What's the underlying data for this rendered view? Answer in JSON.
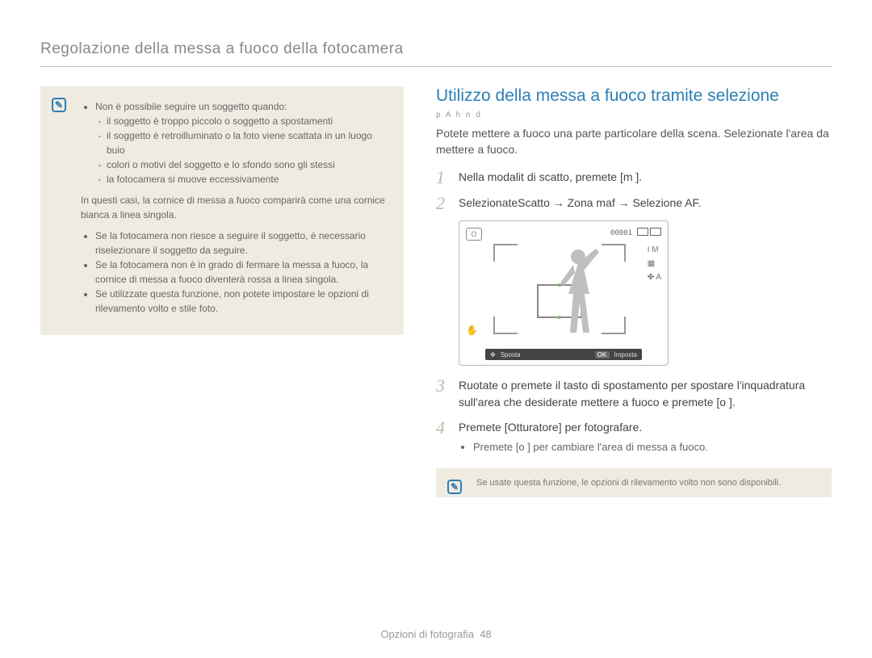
{
  "pageTitle": "Regolazione della messa a fuoco della fotocamera",
  "leftNote": {
    "b1_intro": "Non è possibile seguire un soggetto quando:",
    "b1_sub1": "il soggetto è troppo piccolo o soggetto a spostamenti",
    "b1_sub2": "il soggetto è retroilluminato o la foto viene scattata in un luogo buio",
    "b1_sub3": "colori o motivi del soggetto e lo sfondo sono gli stessi",
    "b1_sub4": "la fotocamera si muove eccessivamente",
    "para": "In questi casi, la cornice di messa a fuoco comparirà come una cornice bianca a linea singola.",
    "b2": "Se la fotocamera non riesce a seguire il soggetto, è necessario riselezionare il soggetto da seguire.",
    "b3": "Se la fotocamera non è in grado di fermare la messa a fuoco, la cornice di messa a fuoco diventerà rossa a linea singola.",
    "b4": "Se utilizzate questa funzione, non potete impostare le opzioni di rilevamento volto e stile foto."
  },
  "section": {
    "title": "Utilizzo della messa a fuoco tramite selezione",
    "modes": "p A h n d",
    "intro": "Potete mettere a fuoco una parte particolare della scena. Selezionate l'area da mettere a fuoco."
  },
  "steps": {
    "s1_num": "1",
    "s1": "Nella modalit di scatto, premete [m     ].",
    "s2_num": "2",
    "s2": "SelezionateScatto → Zona maf → Selezione AF.",
    "s3_num": "3",
    "s3": "Ruotate o premete il tasto di spostamento per spostare l'inquadratura sull'area che desiderate mettere a fuoco e premete [o   ].",
    "s4_num": "4",
    "s4": "Premete [Otturatore] per fotografare.",
    "s4_sub": "Premete [o   ] per cambiare l'area di messa a fuoco."
  },
  "display": {
    "counter": "00001",
    "modeIcon": "O",
    "rightIcon1": "I M",
    "rightIcon2": "▦",
    "rightIcon3": "✤ A",
    "leftIcon": "✋",
    "bottomLeft": "Sposta",
    "bottomOk": "OK",
    "bottomRight": "Imposta"
  },
  "bottomNote": "Se usate questa funzione, le opzioni di rilevamento volto non sono disponibili.",
  "footer": {
    "section": "Opzioni di fotografia",
    "page": "48"
  }
}
